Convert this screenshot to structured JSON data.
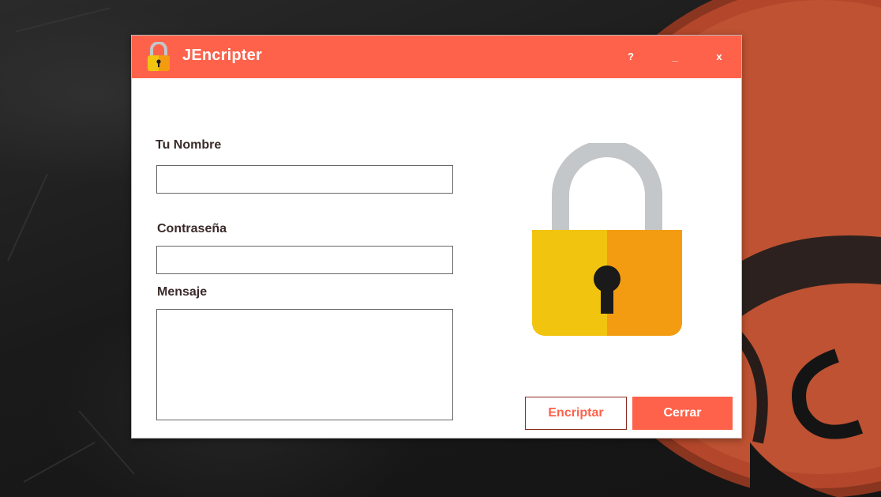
{
  "window": {
    "title": "JEncripter",
    "controls": {
      "help": "?",
      "minimize": "_",
      "close": "x"
    }
  },
  "form": {
    "name_label": "Tu Nombre",
    "name_value": "",
    "password_label": "Contraseña",
    "password_value": "",
    "message_label": "Mensaje",
    "message_value": ""
  },
  "buttons": {
    "encrypt": "Encriptar",
    "close": "Cerrar"
  },
  "icons": {
    "app_icon": "padlock-icon",
    "illustration": "padlock-icon"
  },
  "colors": {
    "accent": "#fe624a",
    "lock_body_left": "#f1c40f",
    "lock_body_right": "#f39c12",
    "lock_shackle": "#c3c7ca",
    "keyhole": "#1a1a1a"
  }
}
